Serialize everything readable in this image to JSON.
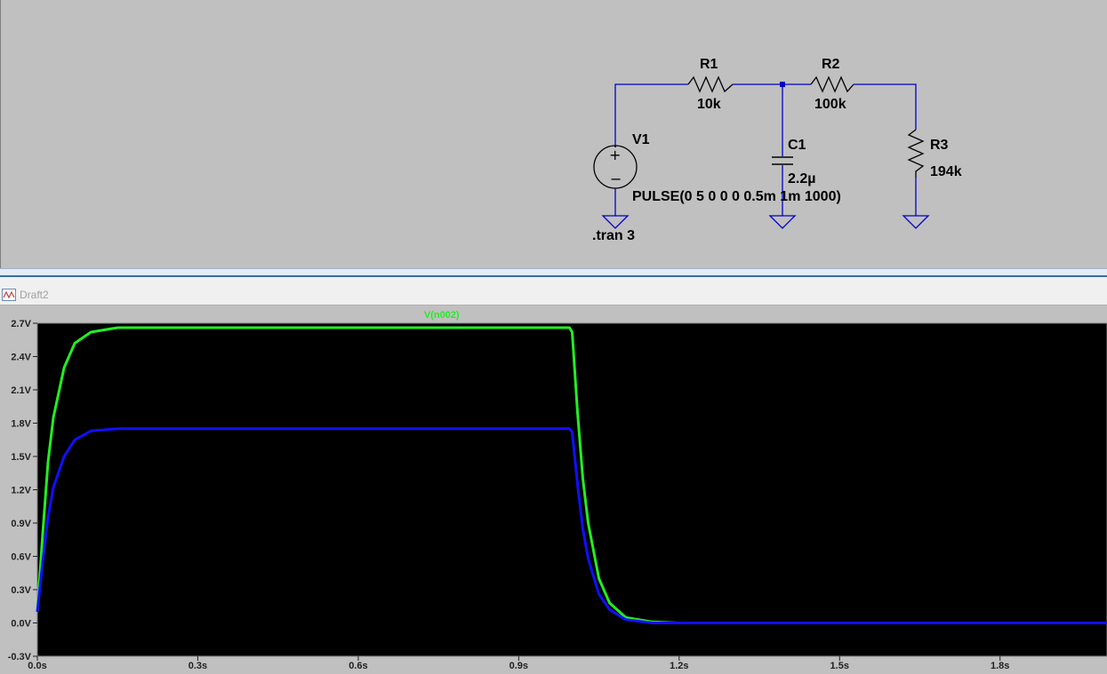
{
  "schematic": {
    "components": {
      "v1": {
        "name": "V1",
        "value": "PULSE(0 5 0 0 0 0.5m 1m 1000)"
      },
      "r1": {
        "name": "R1",
        "value": "10k"
      },
      "r2": {
        "name": "R2",
        "value": "100k"
      },
      "r3": {
        "name": "R3",
        "value": "194k"
      },
      "c1": {
        "name": "C1",
        "value": "2.2µ"
      }
    },
    "directive": ".tran 3",
    "wire_color": "#0000c8"
  },
  "plot_window": {
    "title": "Draft2",
    "icon": "waveform-icon"
  },
  "chart_data": {
    "type": "line",
    "background": "#000000",
    "xlim": [
      0,
      2.0
    ],
    "ylim": [
      -0.3,
      2.7
    ],
    "x_ticks": [
      0.0,
      0.3,
      0.6,
      0.9,
      1.2,
      1.5,
      1.8
    ],
    "x_tick_labels": [
      "0.0s",
      "0.3s",
      "0.6s",
      "0.9s",
      "1.2s",
      "1.5s",
      "1.8s"
    ],
    "y_ticks": [
      2.7,
      2.4,
      2.1,
      1.8,
      1.5,
      1.2,
      0.9,
      0.6,
      0.3,
      0.0,
      -0.3
    ],
    "y_tick_labels": [
      "2.7V",
      "2.4V",
      "2.1V",
      "1.8V",
      "1.5V",
      "1.2V",
      "0.9V",
      "0.6V",
      "0.3V",
      "0.0V",
      "-0.3V"
    ],
    "grid": false,
    "series": [
      {
        "name": "V(n002)",
        "color": "#22ee22",
        "x": [
          0.0,
          0.01,
          0.02,
          0.03,
          0.05,
          0.07,
          0.1,
          0.15,
          0.2,
          0.5,
          0.995,
          1.0,
          1.01,
          1.02,
          1.03,
          1.05,
          1.07,
          1.1,
          1.15,
          1.2,
          2.0
        ],
        "values": [
          0.1,
          0.8,
          1.45,
          1.85,
          2.3,
          2.52,
          2.62,
          2.66,
          2.66,
          2.66,
          2.66,
          2.62,
          1.9,
          1.3,
          0.9,
          0.4,
          0.18,
          0.05,
          0.01,
          0.0,
          0.0
        ]
      },
      {
        "name": "",
        "color": "#1010ff",
        "x": [
          0.0,
          0.01,
          0.02,
          0.03,
          0.05,
          0.07,
          0.1,
          0.15,
          0.2,
          0.5,
          0.995,
          1.0,
          1.01,
          1.02,
          1.03,
          1.05,
          1.07,
          1.1,
          1.15,
          1.2,
          2.0
        ],
        "values": [
          0.1,
          0.55,
          0.95,
          1.22,
          1.5,
          1.65,
          1.73,
          1.75,
          1.75,
          1.75,
          1.75,
          1.72,
          1.25,
          0.85,
          0.58,
          0.26,
          0.12,
          0.03,
          0.0,
          0.0,
          0.0
        ]
      }
    ]
  }
}
